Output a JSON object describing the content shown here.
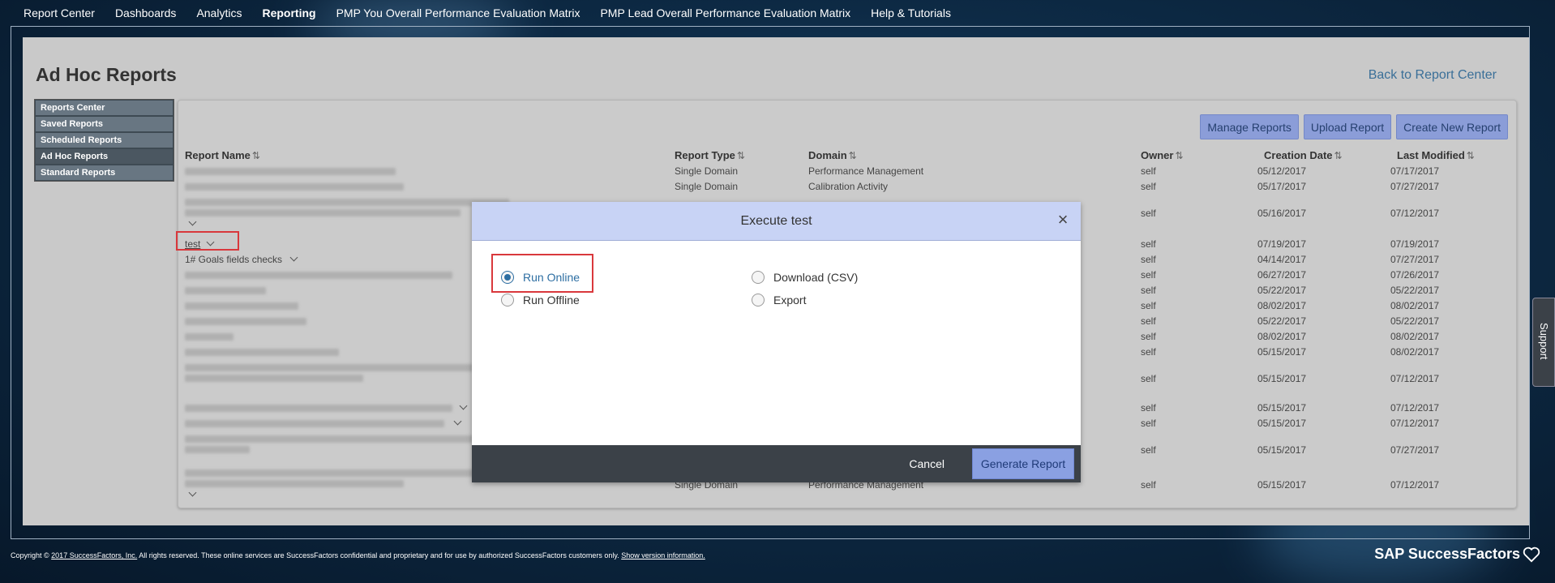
{
  "topnav": {
    "items": [
      "Report Center",
      "Dashboards",
      "Analytics",
      "Reporting",
      "PMP You Overall Performance Evaluation Matrix",
      "PMP Lead Overall Performance Evaluation Matrix",
      "Help & Tutorials"
    ],
    "active": "Reporting"
  },
  "page": {
    "title": "Ad Hoc Reports",
    "back_link": "Back to Report Center"
  },
  "leftnav": {
    "items": [
      "Reports Center",
      "Saved Reports",
      "Scheduled Reports",
      "Ad Hoc Reports",
      "Standard Reports"
    ],
    "selected": "Ad Hoc Reports"
  },
  "actions": {
    "manage": "Manage Reports",
    "upload": "Upload Report",
    "create": "Create New Report"
  },
  "table": {
    "headers": {
      "name": "Report Name",
      "type": "Report Type",
      "domain": "Domain",
      "owner": "Owner",
      "created": "Creation Date",
      "modified": "Last Modified"
    },
    "sort_glyph": "⇅",
    "rows": [
      {
        "name": "",
        "type": "Single Domain",
        "domain": "Performance Management",
        "owner": "self",
        "created": "05/12/2017",
        "modified": "07/17/2017"
      },
      {
        "name": "",
        "type": "Single Domain",
        "domain": "Calibration Activity",
        "owner": "self",
        "created": "05/17/2017",
        "modified": "07/27/2017"
      },
      {
        "name": "",
        "type": "",
        "domain": "",
        "owner": "self",
        "created": "05/16/2017",
        "modified": "07/12/2017"
      },
      {
        "name": "test",
        "type": "",
        "domain": "",
        "owner": "self",
        "created": "07/19/2017",
        "modified": "07/19/2017"
      },
      {
        "name": "1# Goals fields checks",
        "type": "",
        "domain": "",
        "owner": "self",
        "created": "04/14/2017",
        "modified": "07/27/2017"
      },
      {
        "name": "",
        "type": "",
        "domain": "",
        "owner": "self",
        "created": "06/27/2017",
        "modified": "07/26/2017"
      },
      {
        "name": "",
        "type": "",
        "domain": "",
        "owner": "self",
        "created": "05/22/2017",
        "modified": "05/22/2017"
      },
      {
        "name": "",
        "type": "",
        "domain": "",
        "owner": "self",
        "created": "08/02/2017",
        "modified": "08/02/2017"
      },
      {
        "name": "",
        "type": "",
        "domain": "",
        "owner": "self",
        "created": "05/22/2017",
        "modified": "05/22/2017"
      },
      {
        "name": "",
        "type": "",
        "domain": "",
        "owner": "self",
        "created": "08/02/2017",
        "modified": "08/02/2017"
      },
      {
        "name": "",
        "type": "",
        "domain": "",
        "owner": "self",
        "created": "05/15/2017",
        "modified": "08/02/2017"
      },
      {
        "name": "",
        "type": "",
        "domain": "",
        "owner": "self",
        "created": "05/15/2017",
        "modified": "07/12/2017"
      },
      {
        "name": "",
        "type": "",
        "domain": "",
        "owner": "self",
        "created": "05/15/2017",
        "modified": "07/12/2017"
      },
      {
        "name": "",
        "type": "",
        "domain": "",
        "owner": "self",
        "created": "05/15/2017",
        "modified": "07/12/2017"
      },
      {
        "name": "",
        "type": "",
        "domain": "",
        "owner": "self",
        "created": "05/15/2017",
        "modified": "07/27/2017"
      },
      {
        "name": "",
        "type": "Single Domain",
        "domain": "Performance Management",
        "owner": "self",
        "created": "05/15/2017",
        "modified": "07/12/2017"
      }
    ]
  },
  "modal": {
    "title": "Execute test",
    "close": "×",
    "options": {
      "run_online": "Run Online",
      "run_offline": "Run Offline",
      "download_csv": "Download (CSV)",
      "export": "Export"
    },
    "selected_option": "Run Online",
    "cancel": "Cancel",
    "generate": "Generate Report"
  },
  "footer": {
    "copyright_prefix": "Copyright ©",
    "copyright_link": "2017 SuccessFactors, Inc.",
    "copyright_text": "All rights reserved. These online services are SuccessFactors confidential and proprietary and for use by authorized SuccessFactors customers only.",
    "version_link": "Show version information.",
    "brand": "SAP SuccessFactors",
    "support": "Support"
  },
  "colors": {
    "accent_button": "#8b9dd8",
    "modal_header": "#c8d3f5",
    "footer_bar": "#3b4148",
    "highlight": "#d9383c"
  }
}
